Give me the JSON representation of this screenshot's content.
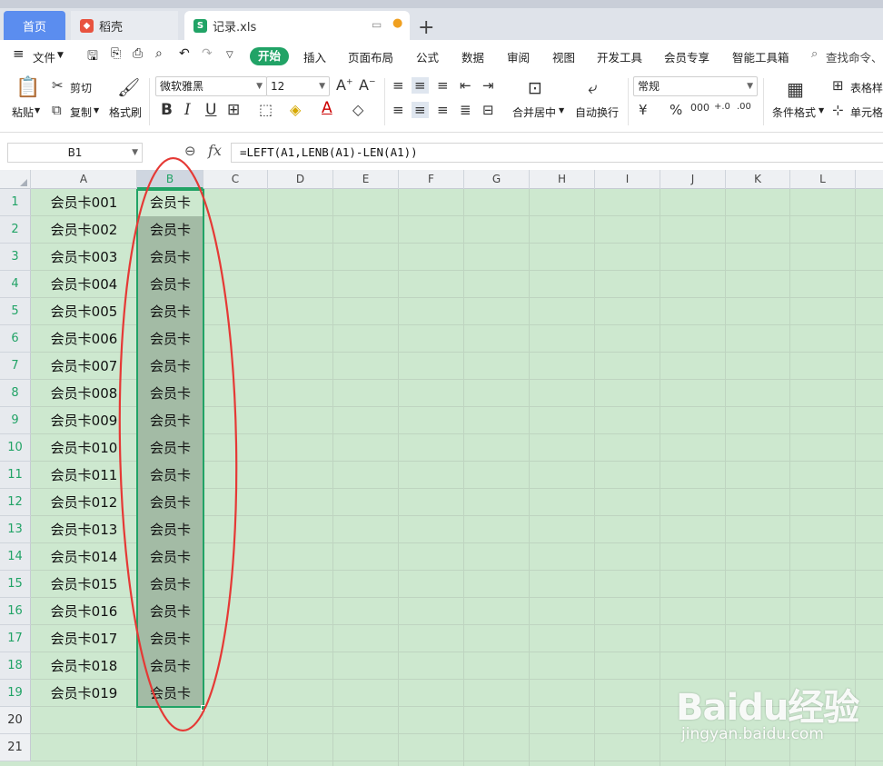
{
  "tabs": {
    "home": "首页",
    "daoke": "稻壳",
    "doc": "记录.xls",
    "add": "+"
  },
  "menu": {
    "file": "文件",
    "start": "开始",
    "items": [
      "插入",
      "页面布局",
      "公式",
      "数据",
      "审阅",
      "视图",
      "开发工具",
      "会员专享",
      "智能工具箱"
    ],
    "search": "查找命令、"
  },
  "ribbon": {
    "paste": "粘贴",
    "cut": "剪切",
    "copy": "复制",
    "format_painter": "格式刷",
    "font": "微软雅黑",
    "size": "12",
    "merge": "合并居中",
    "wrap": "自动换行",
    "number_format": "常规",
    "cond_format": "条件格式",
    "table_style": "表格样",
    "cell": "单元格"
  },
  "formula_bar": {
    "cell_ref": "B1",
    "fx": "fx",
    "formula": "=LEFT(A1,LENB(A1)-LEN(A1))"
  },
  "columns": [
    "A",
    "B",
    "C",
    "D",
    "E",
    "F",
    "G",
    "H",
    "I",
    "J",
    "K",
    "L"
  ],
  "rows": [
    {
      "num": "1",
      "a": "会员卡001",
      "b": "会员卡"
    },
    {
      "num": "2",
      "a": "会员卡002",
      "b": "会员卡"
    },
    {
      "num": "3",
      "a": "会员卡003",
      "b": "会员卡"
    },
    {
      "num": "4",
      "a": "会员卡004",
      "b": "会员卡"
    },
    {
      "num": "5",
      "a": "会员卡005",
      "b": "会员卡"
    },
    {
      "num": "6",
      "a": "会员卡006",
      "b": "会员卡"
    },
    {
      "num": "7",
      "a": "会员卡007",
      "b": "会员卡"
    },
    {
      "num": "8",
      "a": "会员卡008",
      "b": "会员卡"
    },
    {
      "num": "9",
      "a": "会员卡009",
      "b": "会员卡"
    },
    {
      "num": "10",
      "a": "会员卡010",
      "b": "会员卡"
    },
    {
      "num": "11",
      "a": "会员卡011",
      "b": "会员卡"
    },
    {
      "num": "12",
      "a": "会员卡012",
      "b": "会员卡"
    },
    {
      "num": "13",
      "a": "会员卡013",
      "b": "会员卡"
    },
    {
      "num": "14",
      "a": "会员卡014",
      "b": "会员卡"
    },
    {
      "num": "15",
      "a": "会员卡015",
      "b": "会员卡"
    },
    {
      "num": "16",
      "a": "会员卡016",
      "b": "会员卡"
    },
    {
      "num": "17",
      "a": "会员卡017",
      "b": "会员卡"
    },
    {
      "num": "18",
      "a": "会员卡018",
      "b": "会员卡"
    },
    {
      "num": "19",
      "a": "会员卡019",
      "b": "会员卡"
    },
    {
      "num": "20",
      "a": "",
      "b": ""
    },
    {
      "num": "21",
      "a": "",
      "b": ""
    }
  ],
  "selected_column": "B",
  "annotation_color": "#e53935",
  "accent_color": "#21a366",
  "watermark": {
    "logo": "Baidu经验",
    "url": "jingyan.baidu.com"
  }
}
